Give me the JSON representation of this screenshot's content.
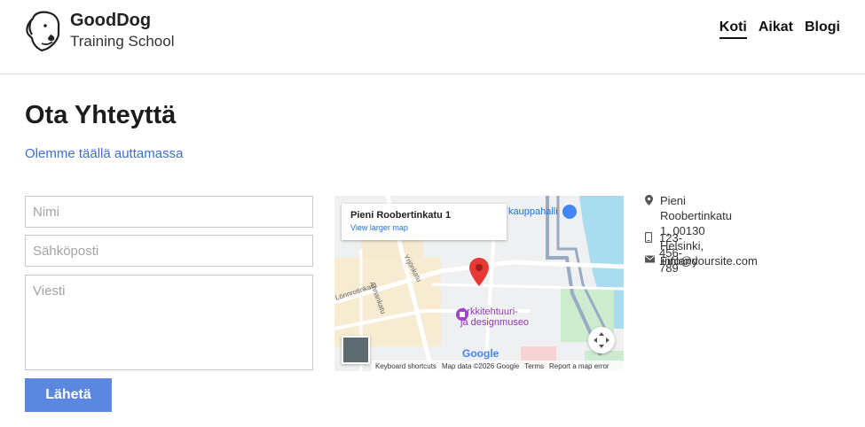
{
  "brand": {
    "name": "GoodDog",
    "subtitle": "Training School",
    "logo_icon": "dog-head-icon"
  },
  "nav": {
    "items": [
      {
        "label": "Koti",
        "active": true
      },
      {
        "label": "Aikat",
        "active": false
      },
      {
        "label": "Blogi",
        "active": false
      }
    ]
  },
  "page": {
    "title": "Ota Yhteyttä",
    "subtitle": "Olemme täällä auttamassa"
  },
  "form": {
    "name_placeholder": "Nimi",
    "email_placeholder": "Sähköposti",
    "message_placeholder": "Viesti",
    "submit_label": "Lähetä"
  },
  "map": {
    "place_title": "Pieni Roobertinkatu 1",
    "view_larger": "View larger map",
    "poi_shop": "kauppahalli",
    "poi_museum_line1": "Arkkitehtuuri-",
    "poi_museum_line2": "ja designmuseo",
    "google": "Google",
    "attribution": {
      "shortcuts": "Keyboard shortcuts",
      "data": "Map data ©2026 Google",
      "terms": "Terms",
      "report": "Report a map error"
    },
    "street_labels": [
      "Yrjönkatu",
      "Annankatu",
      "Lönnrotinkatu"
    ]
  },
  "contact": {
    "address_line1": "Pieni Roobertinkatu 1, 00130",
    "address_line2": "Helsinki, Finland",
    "phone": "123-456-789",
    "email": "info@yoursite.com",
    "icons": [
      "location-pin-icon",
      "phone-icon",
      "mail-icon"
    ]
  },
  "colors": {
    "accent": "#5b87e0",
    "link": "#3d6fd6",
    "map_water": "#a9dcef",
    "map_pin": "#e53935"
  }
}
